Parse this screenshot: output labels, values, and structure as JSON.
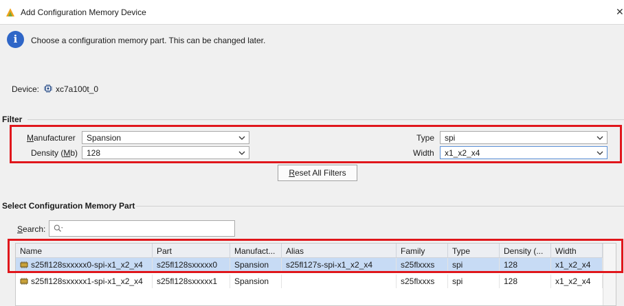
{
  "window": {
    "title": "Add Configuration Memory Device",
    "close_icon": "close-icon"
  },
  "info": {
    "icon": "info-icon",
    "text": "Choose a configuration memory part. This can be changed later."
  },
  "device": {
    "label": "Device:",
    "value": "xc7a100t_0",
    "icon": "chip-icon"
  },
  "filter": {
    "title": "Filter",
    "manufacturer": {
      "label_pre": "",
      "label_u": "M",
      "label_post": "anufacturer",
      "value": "Spansion"
    },
    "density": {
      "label_pre": "Density (",
      "label_u": "M",
      "label_post": "b)",
      "value": "128"
    },
    "type": {
      "label": "Type",
      "value": "spi"
    },
    "width": {
      "label": "Width",
      "value": "x1_x2_x4"
    },
    "reset": {
      "label_u": "R",
      "label_post": "eset All Filters"
    }
  },
  "parts": {
    "title": "Select Configuration Memory Part",
    "search": {
      "label_u": "S",
      "label_post": "earch:",
      "placeholder_icon": "search-icon"
    },
    "columns": [
      "Name",
      "Part",
      "Manufact...",
      "Alias",
      "Family",
      "Type",
      "Density (...",
      "Width"
    ],
    "rows": [
      {
        "name": "s25fl128sxxxxx0-spi-x1_x2_x4",
        "part": "s25fl128sxxxxx0",
        "manufacturer": "Spansion",
        "alias": "s25fl127s-spi-x1_x2_x4",
        "family": "s25flxxxs",
        "type": "spi",
        "density": "128",
        "width": "x1_x2_x4",
        "selected": true
      },
      {
        "name": "s25fl128sxxxxx1-spi-x1_x2_x4",
        "part": "s25fl128sxxxxx1",
        "manufacturer": "Spansion",
        "alias": "",
        "family": "s25flxxxs",
        "type": "spi",
        "density": "128",
        "width": "x1_x2_x4",
        "selected": false
      }
    ]
  },
  "colors": {
    "highlight_red": "#e0161b",
    "selected_row": "#c7dbf5",
    "info_blue": "#2f66c7"
  }
}
